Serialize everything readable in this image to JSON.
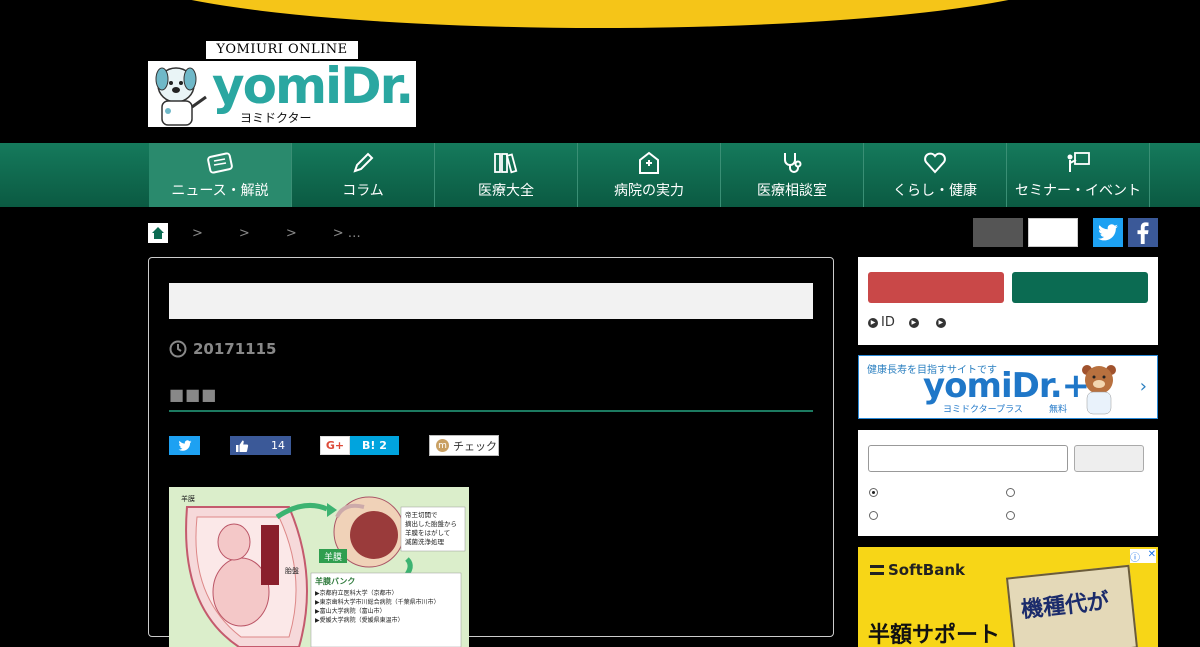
{
  "logo": {
    "tagline": "YOMIURI ONLINE",
    "wordmark": "yomiDr.",
    "subtitle": "ヨミドクター"
  },
  "nav": [
    {
      "label": "ニュース・解説",
      "icon": "newspaper-icon"
    },
    {
      "label": "コラム",
      "icon": "pencil-icon"
    },
    {
      "label": "医療大全",
      "icon": "books-icon"
    },
    {
      "label": "病院の実力",
      "icon": "hospital-icon"
    },
    {
      "label": "医療相談室",
      "icon": "stethoscope-icon"
    },
    {
      "label": "くらし・健康",
      "icon": "heart-icon"
    },
    {
      "label": "セミナー・イベント",
      "icon": "presentation-icon"
    }
  ],
  "breadcrumb": {
    "separators": [
      ">",
      ">",
      ">",
      "> …"
    ]
  },
  "article": {
    "date": "20171115",
    "lead": "■■■"
  },
  "share": {
    "like_count": "14",
    "gplus": "G+",
    "hatena": "B! 2",
    "check": "チェック"
  },
  "figure": {
    "labels": {
      "amnion_top": "羊膜",
      "placenta": "胎盤",
      "note": "帝王切開で\n摘出した胎盤から\n羊膜をはがして\n滅菌洗浄処理",
      "amnion_tag": "羊膜",
      "bank_title": "羊膜バンク",
      "bank_items": [
        "▶京都府立医科大学（京都市）",
        "▶東京歯科大学市川総合病院（千葉県市川市）",
        "▶富山大学病院（富山市）",
        "▶愛媛大学病院（愛媛県東温市）"
      ]
    }
  },
  "sidebar": {
    "link_id": "ID",
    "banner": {
      "small": "健康長寿を目指すサイトです",
      "big": "yomiDr.+",
      "sub": "ヨミドクタープラス",
      "free": "無料"
    }
  },
  "ad": {
    "brand": "SoftBank",
    "tag": "機種代が",
    "bottom": "半額サポート"
  },
  "colors": {
    "nav_green": "#157a5c",
    "accent_yellow": "#f5c518",
    "twitter": "#1da1f2",
    "facebook": "#3b5998"
  }
}
